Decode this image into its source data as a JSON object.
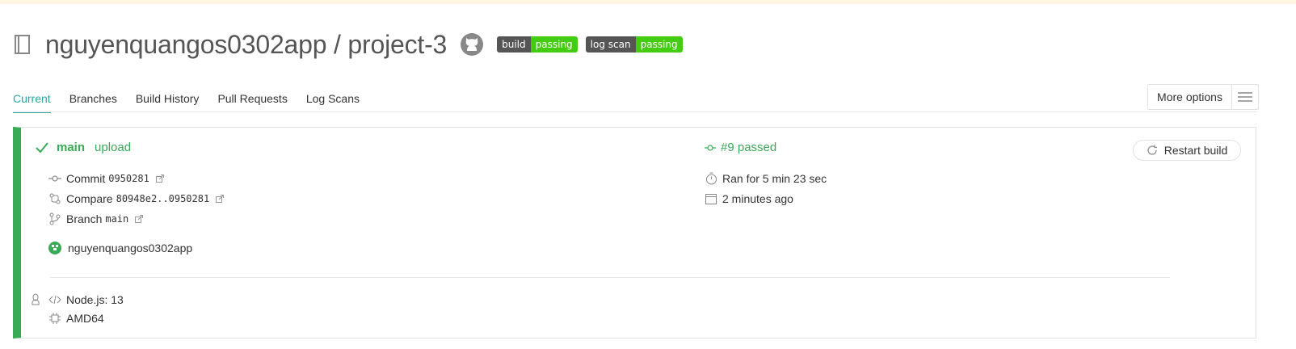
{
  "repo": {
    "title": "nguyenquangos0302app / project-3",
    "badges": [
      {
        "label": "build",
        "value": "passing"
      },
      {
        "label": "log scan",
        "value": "passing"
      }
    ]
  },
  "tabs": [
    "Current",
    "Branches",
    "Build History",
    "Pull Requests",
    "Log Scans"
  ],
  "more_options": "More options",
  "build": {
    "branch": "main",
    "message": "upload",
    "commit_label": "Commit",
    "commit_hash": "0950281",
    "compare_label": "Compare",
    "compare_range": "80948e2..0950281",
    "branch_label": "Branch",
    "branch_value": "main",
    "author": "nguyenquangos0302app",
    "number": "#9 passed",
    "duration": "Ran for 5 min 23 sec",
    "time_ago": "2 minutes ago",
    "restart": "Restart build",
    "language": "Node.js: 13",
    "arch": "AMD64"
  },
  "colors": {
    "accent": "#2aa7a0",
    "passed": "#39aa56",
    "badge_dark": "#555555",
    "badge_green": "#44cc11"
  }
}
